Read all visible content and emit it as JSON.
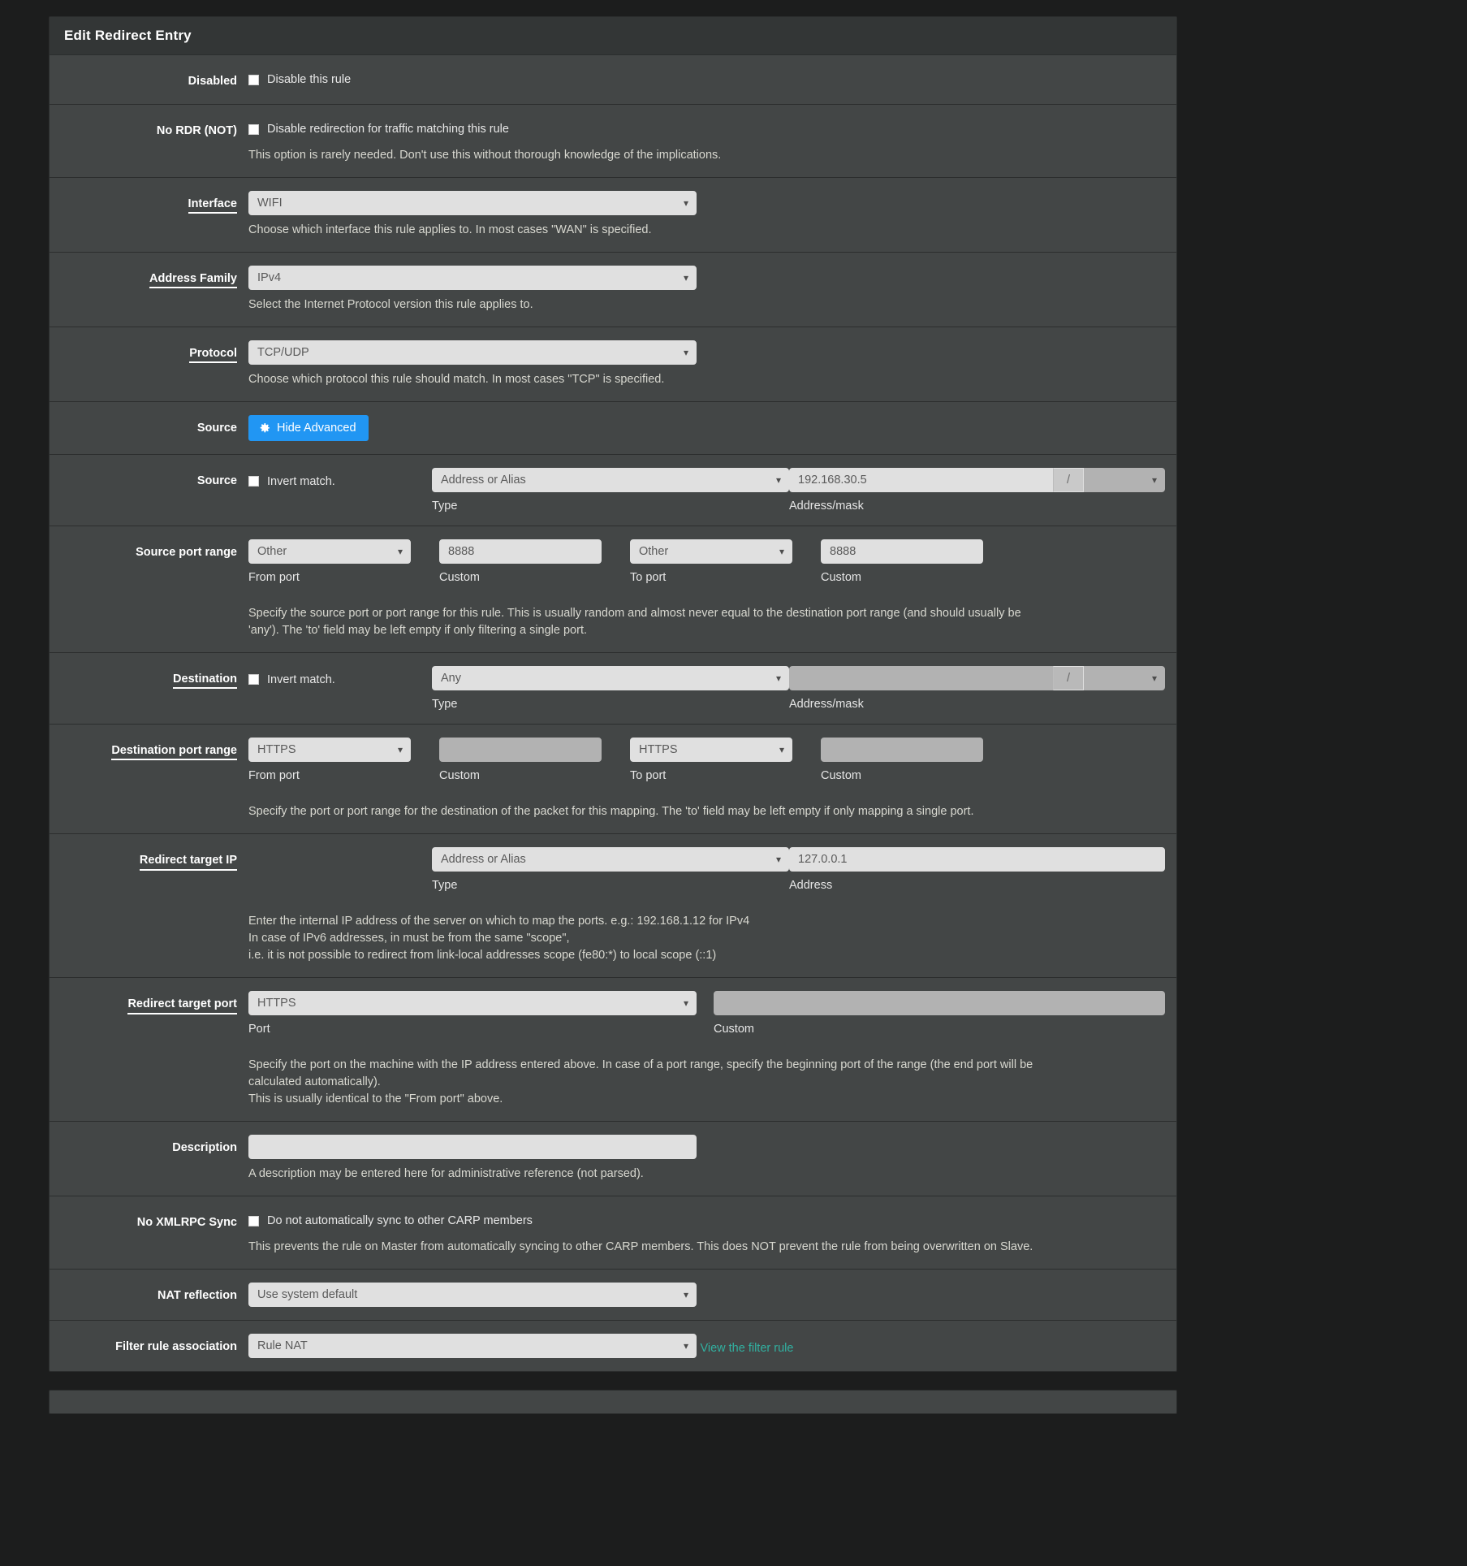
{
  "panel": {
    "title": "Edit Redirect Entry"
  },
  "rows": {
    "disabled": {
      "label": "Disabled",
      "checkbox_label": "Disable this rule",
      "checked": false
    },
    "no_rdr": {
      "label": "No RDR (NOT)",
      "checkbox_label": "Disable redirection for traffic matching this rule",
      "checked": false,
      "help": "This option is rarely needed. Don't use this without thorough knowledge of the implications."
    },
    "interface": {
      "label": "Interface",
      "required": true,
      "value": "WIFI",
      "help": "Choose which interface this rule applies to. In most cases \"WAN\" is specified."
    },
    "address_family": {
      "label": "Address Family",
      "required": true,
      "value": "IPv4",
      "help": "Select the Internet Protocol version this rule applies to."
    },
    "protocol": {
      "label": "Protocol",
      "required": true,
      "value": "TCP/UDP",
      "help": "Choose which protocol this rule should match. In most cases \"TCP\" is specified."
    },
    "source_toggle": {
      "label": "Source",
      "button_label": "Hide Advanced",
      "icon": "gear-icon",
      "accent": "#2196f3"
    },
    "source": {
      "label": "Source",
      "invert_label": "Invert match.",
      "invert_checked": false,
      "type_value": "Address or Alias",
      "type_sublabel": "Type",
      "address_value": "192.168.30.5",
      "slash": "/",
      "mask_value": "",
      "address_sublabel": "Address/mask"
    },
    "source_port_range": {
      "label": "Source port range",
      "from_value": "Other",
      "from_sublabel": "From port",
      "from_custom_value": "8888",
      "from_custom_sublabel": "Custom",
      "to_value": "Other",
      "to_sublabel": "To port",
      "to_custom_value": "8888",
      "to_custom_sublabel": "Custom",
      "help_line1": "Specify the source port or port range for this rule. This is usually random and almost never equal to the destination port range (and should usually be",
      "help_line2": "'any'). The 'to' field may be left empty if only filtering a single port."
    },
    "destination": {
      "label": "Destination",
      "required": true,
      "invert_label": "Invert match.",
      "invert_checked": false,
      "type_value": "Any",
      "type_sublabel": "Type",
      "address_value": "",
      "slash": "/",
      "mask_value": "",
      "address_sublabel": "Address/mask"
    },
    "destination_port_range": {
      "label": "Destination port range",
      "required": true,
      "from_value": "HTTPS",
      "from_sublabel": "From port",
      "from_custom_value": "",
      "from_custom_sublabel": "Custom",
      "to_value": "HTTPS",
      "to_sublabel": "To port",
      "to_custom_value": "",
      "to_custom_sublabel": "Custom",
      "help": "Specify the port or port range for the destination of the packet for this mapping. The 'to' field may be left empty if only mapping a single port."
    },
    "redirect_target_ip": {
      "label": "Redirect target IP",
      "required": true,
      "type_value": "Address or Alias",
      "type_sublabel": "Type",
      "address_value": "127.0.0.1",
      "address_sublabel": "Address",
      "help_line1": "Enter the internal IP address of the server on which to map the ports. e.g.: 192.168.1.12 for IPv4",
      "help_line2": "In case of IPv6 addresses, in must be from the same \"scope\",",
      "help_line3": "i.e. it is not possible to redirect from link-local addresses scope (fe80:*) to local scope (::1)"
    },
    "redirect_target_port": {
      "label": "Redirect target port",
      "required": true,
      "port_value": "HTTPS",
      "port_sublabel": "Port",
      "custom_value": "",
      "custom_sublabel": "Custom",
      "help_line1": "Specify the port on the machine with the IP address entered above. In case of a port range, specify the beginning port of the range (the end port will be",
      "help_line2": "calculated automatically).",
      "help_line3": "This is usually identical to the \"From port\" above."
    },
    "description": {
      "label": "Description",
      "value": "",
      "help": "A description may be entered here for administrative reference (not parsed)."
    },
    "no_xmlrpc_sync": {
      "label": "No XMLRPC Sync",
      "checkbox_label": "Do not automatically sync to other CARP members",
      "checked": false,
      "help": "This prevents the rule on Master from automatically syncing to other CARP members. This does NOT prevent the rule from being overwritten on Slave."
    },
    "nat_reflection": {
      "label": "NAT reflection",
      "value": "Use system default"
    },
    "filter_rule_association": {
      "label": "Filter rule association",
      "value": "Rule NAT",
      "link_label": "View the filter rule"
    }
  }
}
